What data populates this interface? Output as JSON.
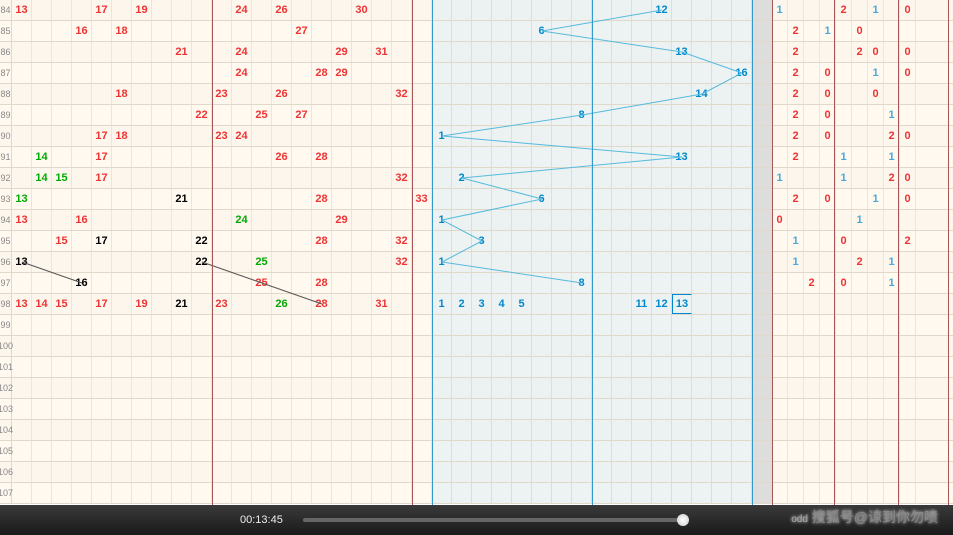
{
  "chart_data": {
    "type": "table",
    "title": "Lottery number trend chart",
    "rows": [
      {
        "id": "84",
        "left": [
          {
            "n": "13",
            "c": "red",
            "x": 13
          },
          {
            "n": "17",
            "c": "red",
            "x": 17
          },
          {
            "n": "19",
            "c": "red",
            "x": 19
          },
          {
            "n": "24",
            "c": "red",
            "x": 24
          },
          {
            "n": "26",
            "c": "red",
            "x": 26
          },
          {
            "n": "30",
            "c": "red",
            "x": 30
          }
        ],
        "blue": {
          "n": "12",
          "x": 12
        },
        "right": [
          "1",
          "",
          "",
          "",
          "2",
          "",
          "1",
          "",
          "0"
        ]
      },
      {
        "id": "85",
        "left": [
          {
            "n": "16",
            "c": "red",
            "x": 16
          },
          {
            "n": "18",
            "c": "red",
            "x": 18
          },
          {
            "n": "27",
            "c": "red",
            "x": 27
          }
        ],
        "blue": {
          "n": "6",
          "x": 6
        },
        "right": [
          "",
          "2",
          "",
          "1",
          "",
          "0",
          "",
          "",
          " "
        ]
      },
      {
        "id": "86",
        "left": [
          {
            "n": "21",
            "c": "red",
            "x": 21
          },
          {
            "n": "24",
            "c": "red",
            "x": 24
          },
          {
            "n": "29",
            "c": "red",
            "x": 29
          },
          {
            "n": "31",
            "c": "red",
            "x": 31
          }
        ],
        "blue": {
          "n": "13",
          "x": 13
        },
        "right": [
          "",
          "2",
          "",
          "",
          "",
          "2",
          "0",
          "",
          "0"
        ]
      },
      {
        "id": "87",
        "left": [
          {
            "n": "24",
            "c": "red",
            "x": 24
          },
          {
            "n": "28",
            "c": "red",
            "x": 28
          },
          {
            "n": "29",
            "c": "red",
            "x": 29
          }
        ],
        "blue": {
          "n": "16",
          "x": 16
        },
        "right": [
          "",
          "2",
          "",
          "0",
          "",
          "",
          "1",
          "",
          "0"
        ]
      },
      {
        "id": "88",
        "left": [
          {
            "n": "18",
            "c": "red",
            "x": 18
          },
          {
            "n": "23",
            "c": "red",
            "x": 23
          },
          {
            "n": "26",
            "c": "red",
            "x": 26
          },
          {
            "n": "32",
            "c": "red",
            "x": 32
          }
        ],
        "blue": {
          "n": "14",
          "x": 14
        },
        "right": [
          "",
          "2",
          "",
          "0",
          "",
          "",
          "0",
          "",
          ""
        ]
      },
      {
        "id": "89",
        "left": [
          {
            "n": "22",
            "c": "red",
            "x": 22
          },
          {
            "n": "25",
            "c": "red",
            "x": 25
          },
          {
            "n": "27",
            "c": "red",
            "x": 27
          }
        ],
        "blue": {
          "n": "8",
          "x": 8
        },
        "right": [
          "",
          "2",
          "",
          "0",
          "",
          "",
          "",
          "1",
          ""
        ]
      },
      {
        "id": "90",
        "left": [
          {
            "n": "17",
            "c": "red",
            "x": 17
          },
          {
            "n": "18",
            "c": "red",
            "x": 18
          },
          {
            "n": "23",
            "c": "red",
            "x": 23
          },
          {
            "n": "24",
            "c": "red",
            "x": 24
          }
        ],
        "blue": {
          "n": "1",
          "x": 1
        },
        "right": [
          "",
          "2",
          "",
          "0",
          "",
          "",
          "",
          "2",
          "0"
        ]
      },
      {
        "id": "91",
        "left": [
          {
            "n": "14",
            "c": "green",
            "x": 14
          },
          {
            "n": "17",
            "c": "red",
            "x": 17
          },
          {
            "n": "26",
            "c": "red",
            "x": 26
          },
          {
            "n": "28",
            "c": "red",
            "x": 28
          }
        ],
        "blue": {
          "n": "13",
          "x": 13
        },
        "right": [
          "",
          "2",
          "",
          "",
          "1",
          "",
          "",
          "1",
          ""
        ]
      },
      {
        "id": "92",
        "left": [
          {
            "n": "14",
            "c": "green",
            "x": 14
          },
          {
            "n": "15",
            "c": "green",
            "x": 15
          },
          {
            "n": "17",
            "c": "red",
            "x": 17
          },
          {
            "n": "32",
            "c": "red",
            "x": 32
          }
        ],
        "blue": {
          "n": "2",
          "x": 2
        },
        "right": [
          "1",
          "",
          "",
          "",
          "1",
          "",
          "",
          "2",
          "0"
        ]
      },
      {
        "id": "93",
        "left": [
          {
            "n": "13",
            "c": "green",
            "x": 13
          },
          {
            "n": "21",
            "c": "black",
            "x": 21
          },
          {
            "n": "28",
            "c": "red",
            "x": 28
          },
          {
            "n": "33",
            "c": "red",
            "x": 33
          }
        ],
        "blue": {
          "n": "6",
          "x": 6
        },
        "right": [
          "",
          "2",
          "",
          "0",
          "",
          "",
          "1",
          "",
          "0"
        ]
      },
      {
        "id": "94",
        "left": [
          {
            "n": "13",
            "c": "red",
            "x": 13
          },
          {
            "n": "16",
            "c": "red",
            "x": 16
          },
          {
            "n": "24",
            "c": "green",
            "x": 24
          },
          {
            "n": "29",
            "c": "red",
            "x": 29
          }
        ],
        "blue": {
          "n": "1",
          "x": 1
        },
        "right": [
          "0",
          "",
          "",
          "",
          "",
          "1",
          "",
          "",
          ""
        ]
      },
      {
        "id": "95",
        "left": [
          {
            "n": "15",
            "c": "red",
            "x": 15
          },
          {
            "n": "17",
            "c": "black",
            "x": 17
          },
          {
            "n": "22",
            "c": "black",
            "x": 22
          },
          {
            "n": "28",
            "c": "red",
            "x": 28
          },
          {
            "n": "32",
            "c": "red",
            "x": 32
          }
        ],
        "blue": {
          "n": "3",
          "x": 3
        },
        "right": [
          "",
          "1",
          "",
          "",
          "0",
          "",
          "",
          "",
          "2"
        ]
      },
      {
        "id": "96",
        "left": [
          {
            "n": "13",
            "c": "black",
            "x": 13
          },
          {
            "n": "22",
            "c": "black",
            "x": 22
          },
          {
            "n": "25",
            "c": "green",
            "x": 25
          },
          {
            "n": "32",
            "c": "red",
            "x": 32
          }
        ],
        "blue": {
          "n": "1",
          "x": 1
        },
        "right": [
          "",
          "1",
          "",
          "",
          "",
          "2",
          "",
          "1",
          ""
        ]
      },
      {
        "id": "97",
        "left": [
          {
            "n": "16",
            "c": "black",
            "x": 16
          },
          {
            "n": "25",
            "c": "red",
            "x": 25
          },
          {
            "n": "28",
            "c": "red",
            "x": 28
          }
        ],
        "blue": {
          "n": "8",
          "x": 8
        },
        "right": [
          "",
          "",
          "2",
          "",
          "0",
          "",
          "",
          "1",
          ""
        ]
      },
      {
        "id": "98",
        "left": [
          {
            "n": "13",
            "c": "red",
            "x": 13
          },
          {
            "n": "14",
            "c": "red",
            "x": 14
          },
          {
            "n": "15",
            "c": "red",
            "x": 15
          },
          {
            "n": "17",
            "c": "red",
            "x": 17
          },
          {
            "n": "19",
            "c": "red",
            "x": 19
          },
          {
            "n": "21",
            "c": "black",
            "x": 21
          },
          {
            "n": "23",
            "c": "red",
            "x": 23
          },
          {
            "n": "26",
            "c": "green",
            "x": 26
          },
          {
            "n": "28",
            "c": "red",
            "x": 28
          },
          {
            "n": "31",
            "c": "red",
            "x": 31
          }
        ],
        "blue_multi": [
          {
            "n": "1",
            "x": 1
          },
          {
            "n": "2",
            "x": 2
          },
          {
            "n": "3",
            "x": 3
          },
          {
            "n": "4",
            "x": 4
          },
          {
            "n": "5",
            "x": 5
          },
          {
            "n": "11",
            "x": 11
          },
          {
            "n": "12",
            "x": 12
          },
          {
            "n": "13",
            "x": 13,
            "boxed": true
          }
        ],
        "right": [
          "",
          "",
          "",
          "",
          "",
          "",
          "",
          "",
          ""
        ]
      },
      {
        "id": "99",
        "left": [],
        "right": [
          "",
          "",
          "",
          "",
          "",
          "",
          "",
          "",
          ""
        ]
      },
      {
        "id": "100",
        "left": [],
        "right": [
          "",
          "",
          "",
          "",
          "",
          "",
          "",
          "",
          ""
        ]
      },
      {
        "id": "101",
        "left": [],
        "right": [
          "",
          "",
          "",
          "",
          "",
          "",
          "",
          "",
          ""
        ]
      },
      {
        "id": "102",
        "left": [],
        "right": [
          "",
          "",
          "",
          "",
          "",
          "",
          "",
          "",
          ""
        ]
      },
      {
        "id": "103",
        "left": [],
        "right": [
          "",
          "",
          "",
          "",
          "",
          "",
          "",
          "",
          ""
        ]
      },
      {
        "id": "104",
        "left": [],
        "right": [
          "",
          "",
          "",
          "",
          "",
          "",
          "",
          "",
          ""
        ]
      },
      {
        "id": "105",
        "left": [],
        "right": [
          "",
          "",
          "",
          "",
          "",
          "",
          "",
          "",
          ""
        ]
      },
      {
        "id": "106",
        "left": [],
        "right": [
          "",
          "",
          "",
          "",
          "",
          "",
          "",
          "",
          ""
        ]
      },
      {
        "id": "107",
        "left": [],
        "right": [
          "",
          "",
          "",
          "",
          "",
          "",
          "",
          "",
          ""
        ]
      }
    ],
    "blue_path": [
      [
        12,
        0
      ],
      [
        6,
        1
      ],
      [
        13,
        2
      ],
      [
        16,
        3
      ],
      [
        14,
        4
      ],
      [
        8,
        5
      ],
      [
        1,
        6
      ],
      [
        13,
        7
      ],
      [
        2,
        8
      ],
      [
        6,
        9
      ],
      [
        1,
        10
      ],
      [
        3,
        11
      ],
      [
        1,
        12
      ],
      [
        8,
        13
      ]
    ],
    "black_path": [
      [
        13,
        12
      ],
      [
        16,
        13
      ]
    ],
    "black_path2": [
      [
        22,
        12
      ],
      [
        25,
        13
      ],
      [
        28,
        14
      ]
    ]
  },
  "player": {
    "time": "00:13:45"
  },
  "watermark": "搜狐号@谅到你勿喷",
  "watermark_suffix": "odd"
}
